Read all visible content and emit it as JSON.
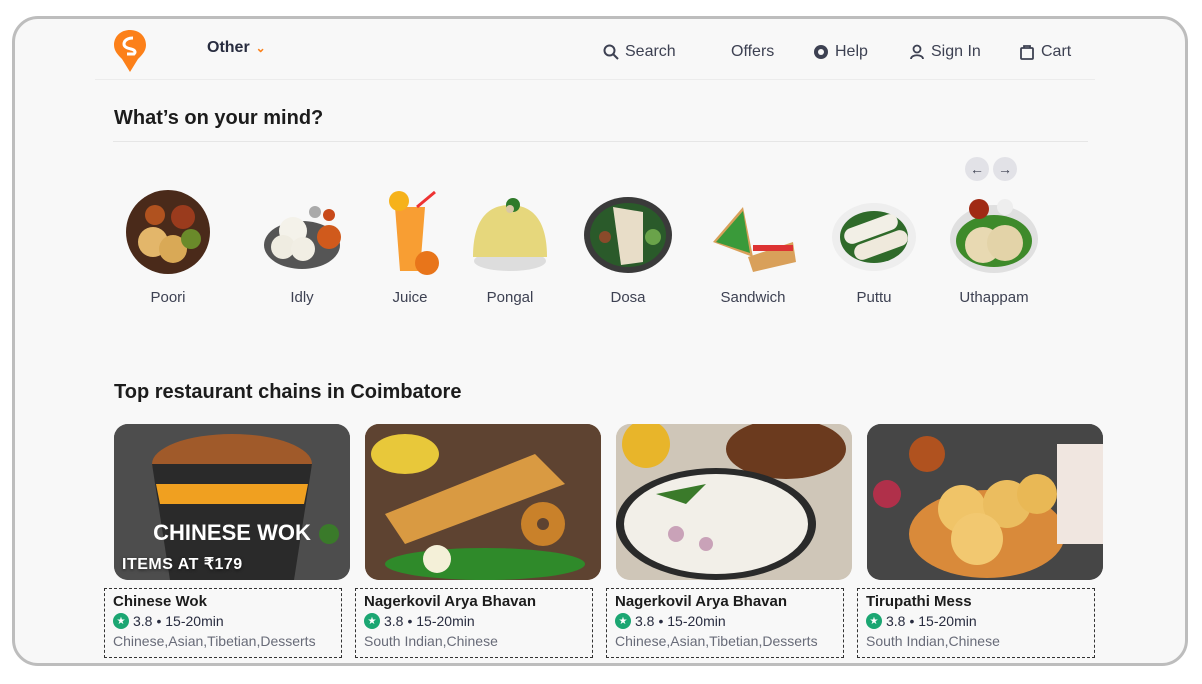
{
  "header": {
    "location": "Other",
    "nav": [
      {
        "label": "Search",
        "icon": "search-icon"
      },
      {
        "label": "Offers",
        "icon": "offers-icon"
      },
      {
        "label": "Help",
        "icon": "help-icon"
      },
      {
        "label": "Sign In",
        "icon": "user-icon"
      },
      {
        "label": "Cart",
        "icon": "bag-icon"
      }
    ],
    "brand_color": "#fc8019"
  },
  "mind": {
    "title": "What’s on your mind?",
    "items": [
      "Poori",
      "Idly",
      "Juice",
      "Pongal",
      "Dosa",
      "Sandwich",
      "Puttu",
      "Uthappam"
    ]
  },
  "chains": {
    "title": "Top restaurant chains in Coimbatore",
    "cards": [
      {
        "name": "Chinese Wok",
        "rating": "3.8",
        "time": "• 15-20min",
        "cuisine": "Chinese,Asian,Tibetian,Desserts",
        "overlay": "ITEMS AT ₹179",
        "pack_text": "CHINESE WOK"
      },
      {
        "name": "Nagerkovil Arya Bhavan",
        "rating": "3.8",
        "time": "• 15-20min",
        "cuisine": "South Indian,Chinese",
        "overlay": ""
      },
      {
        "name": "Nagerkovil Arya Bhavan",
        "rating": "3.8",
        "time": "• 15-20min",
        "cuisine": "Chinese,Asian,Tibetian,Desserts",
        "overlay": ""
      },
      {
        "name": "Tirupathi Mess",
        "rating": "3.8",
        "time": "• 15-20min",
        "cuisine": "South Indian,Chinese",
        "overlay": ""
      }
    ],
    "rating_color": "#1ba672"
  }
}
